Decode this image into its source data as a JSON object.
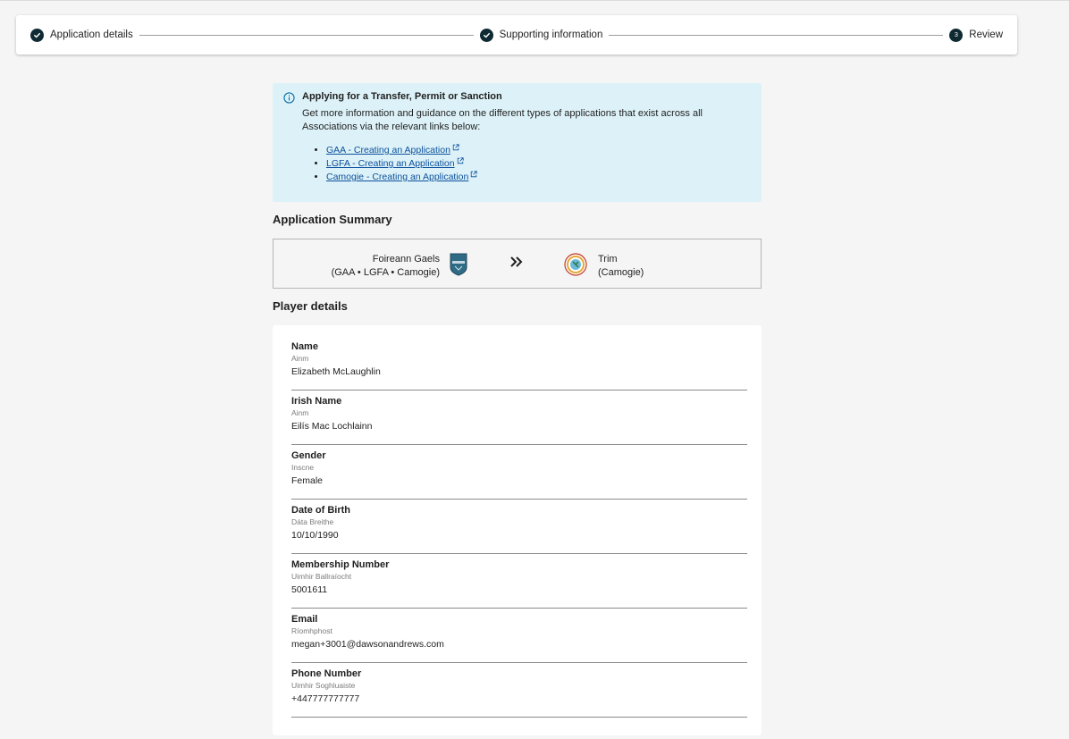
{
  "stepper": {
    "steps": [
      {
        "label": "Application details",
        "state": "complete"
      },
      {
        "label": "Supporting information",
        "state": "complete"
      },
      {
        "label": "Review",
        "state": "current",
        "number": "3"
      }
    ]
  },
  "info_banner": {
    "title": "Applying for a Transfer, Permit or Sanction",
    "text": "Get more information and guidance on the different types of applications that exist across all Associations via the relevant links below:",
    "links": [
      {
        "label": "GAA - Creating an Application"
      },
      {
        "label": "LGFA - Creating an Application"
      },
      {
        "label": "Camogie - Creating an Application"
      }
    ]
  },
  "summary": {
    "title": "Application Summary",
    "from_club": {
      "name": "Foireann Gaels",
      "associations": "(GAA • LGFA • Camogie)"
    },
    "to_club": {
      "name": "Trim",
      "associations": "(Camogie)"
    }
  },
  "player": {
    "title": "Player details",
    "fields": [
      {
        "label": "Name",
        "irish": "Ainm",
        "value": "Elizabeth McLaughlin"
      },
      {
        "label": "Irish Name",
        "irish": "Ainm",
        "value": "Eilís Mac Lochlainn"
      },
      {
        "label": "Gender",
        "irish": "Inscne",
        "value": "Female"
      },
      {
        "label": "Date of Birth",
        "irish": "Dáta Breithe",
        "value": "10/10/1990"
      },
      {
        "label": "Membership Number",
        "irish": "Uimhir Ballraíocht",
        "value": "5001611"
      },
      {
        "label": "Email",
        "irish": "Ríomhphost",
        "value": "megan+3001@dawsonandrews.com"
      },
      {
        "label": "Phone Number",
        "irish": "Uimhir Soghluaiste",
        "value": "+447777777777"
      }
    ]
  },
  "colors": {
    "step_icon": "#0f2a33",
    "info_bg": "#ddf2f8",
    "link": "#0b4f9c",
    "page_bg": "#f5f5f5"
  },
  "icons": {
    "complete_step": "check-circle-icon",
    "info": "info-icon",
    "external_link": "external-link-icon",
    "transfer": "double-chevron-right-icon"
  }
}
